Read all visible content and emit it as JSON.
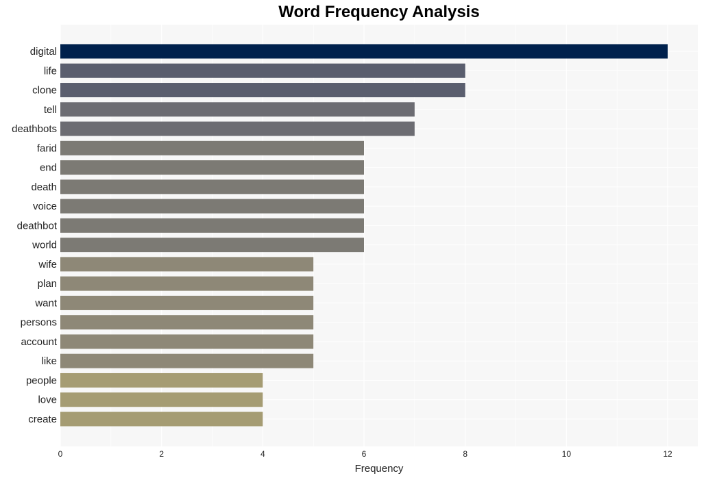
{
  "chart_data": {
    "type": "bar",
    "orientation": "horizontal",
    "title": "Word Frequency Analysis",
    "xlabel": "Frequency",
    "ylabel": "",
    "xlim": [
      0,
      12.6
    ],
    "xticks": [
      0,
      2,
      4,
      6,
      8,
      10,
      12
    ],
    "grid": true,
    "categories": [
      "digital",
      "life",
      "clone",
      "tell",
      "deathbots",
      "farid",
      "end",
      "death",
      "voice",
      "deathbot",
      "world",
      "wife",
      "plan",
      "want",
      "persons",
      "account",
      "like",
      "people",
      "love",
      "create"
    ],
    "values": [
      12,
      8,
      8,
      7,
      7,
      6,
      6,
      6,
      6,
      6,
      6,
      5,
      5,
      5,
      5,
      5,
      5,
      4,
      4,
      4
    ],
    "colors": {
      "12": "#00214d",
      "8": "#5a5e6e",
      "7": "#6c6c72",
      "6": "#7c7a74",
      "5": "#8e8877",
      "4": "#a59c73"
    },
    "plot_background": "#f7f7f7"
  }
}
